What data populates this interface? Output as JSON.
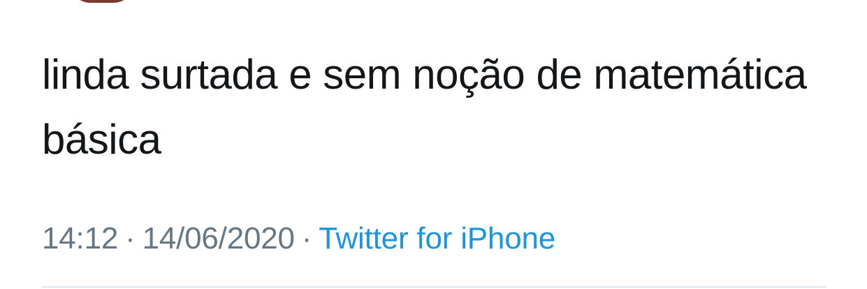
{
  "tweet": {
    "text": "linda surtada e sem noção de matemática básica",
    "time": "14:12",
    "date": "14/06/2020",
    "source": "Twitter for iPhone",
    "separator": "·"
  },
  "colors": {
    "text": "#14171a",
    "meta": "#657786",
    "link": "#1b95e0",
    "divider": "#e1e8ed"
  }
}
